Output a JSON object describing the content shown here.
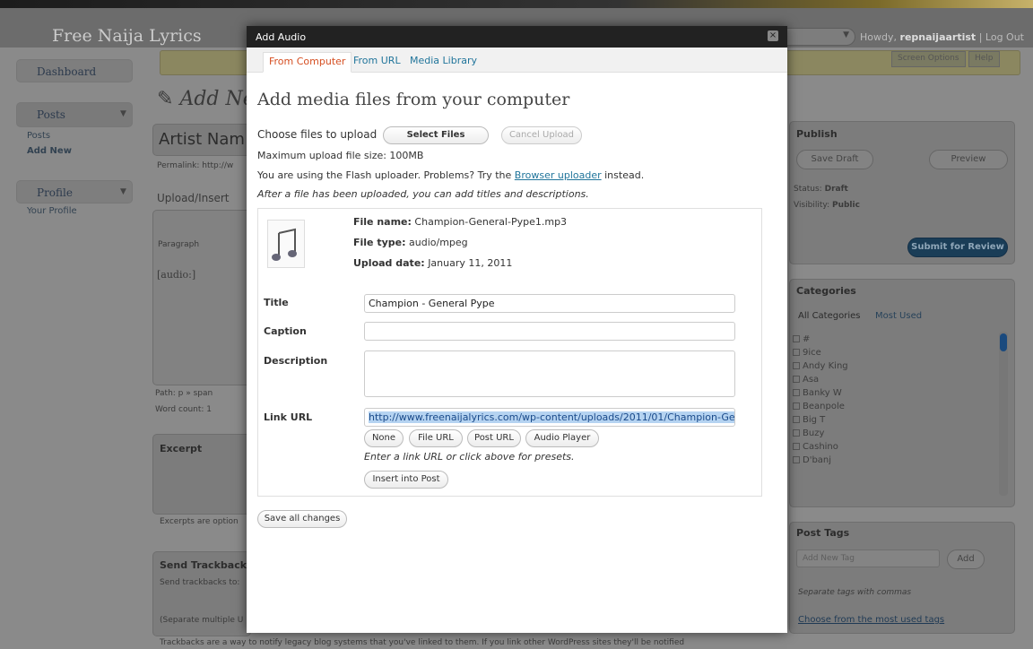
{
  "site": {
    "title": "Free Naija Lyrics",
    "howdy_prefix": "Howdy,",
    "user": "repnaijaartist",
    "separator": "|",
    "logout": "Log Out",
    "screen_options": "Screen Options",
    "help": "Help"
  },
  "sidebar": {
    "dashboard": "Dashboard",
    "posts": "Posts",
    "posts_sub": [
      "Posts",
      "Add New"
    ],
    "profile": "Profile",
    "profile_sub": [
      "Your Profile"
    ]
  },
  "editor": {
    "page_title": "Add Ne",
    "post_title": "Artist Nam",
    "permalink": "Permalink: http://w",
    "upload_insert": "Upload/Insert",
    "paragraph": "Paragraph",
    "content": "[audio:]",
    "path": "Path: p » span",
    "word_count": "Word count: 1",
    "excerpt_title": "Excerpt",
    "excerpt_note": "Excerpts are option",
    "trackbacks_title": "Send Trackbacks",
    "trackbacks_to": "Send trackbacks to:",
    "trackbacks_sep": "(Separate multiple U",
    "trackbacks_info": "Trackbacks are a way to notify legacy blog systems that you've linked to them. If you link other WordPress sites they'll be notified"
  },
  "publish": {
    "title": "Publish",
    "save_draft": "Save Draft",
    "preview": "Preview",
    "status_label": "Status:",
    "status": "Draft",
    "visibility_label": "Visibility:",
    "visibility": "Public",
    "submit": "Submit for Review"
  },
  "categories": {
    "title": "Categories",
    "tab_all": "All Categories",
    "tab_most": "Most Used",
    "items": [
      "#",
      "9ice",
      "Andy King",
      "Asa",
      "Banky W",
      "Beanpole",
      "Big T",
      "Buzy",
      "Cashino",
      "D'banj"
    ]
  },
  "tags": {
    "title": "Post Tags",
    "placeholder": "Add New Tag",
    "add": "Add",
    "hint": "Separate tags with commas",
    "choose": "Choose from the most used tags"
  },
  "modal": {
    "title": "Add Audio",
    "close": "×",
    "tabs": [
      "From Computer",
      "From URL",
      "Media Library"
    ],
    "heading": "Add media files from your computer",
    "choose_label": "Choose files to upload",
    "select_files": "Select Files",
    "cancel_upload": "Cancel Upload",
    "max_size": "Maximum upload file size: 100MB",
    "flash_pre": "You are using the Flash uploader. Problems? Try the",
    "flash_link": "Browser uploader",
    "flash_post": "instead.",
    "after_upload": "After a file has been uploaded, you can add titles and descriptions.",
    "file": {
      "name_label": "File name:",
      "name": "Champion-General-Pype1.mp3",
      "type_label": "File type:",
      "type": "audio/mpeg",
      "date_label": "Upload date:",
      "date": "January 11, 2011"
    },
    "fields": {
      "title_label": "Title",
      "title_value": "Champion - General Pype",
      "caption_label": "Caption",
      "caption_value": "",
      "description_label": "Description",
      "description_value": "",
      "link_label": "Link URL",
      "link_value": "http://www.freenaijalyrics.com/wp-content/uploads/2011/01/Champion-Ge"
    },
    "link_buttons": [
      "None",
      "File URL",
      "Post URL",
      "Audio Player"
    ],
    "link_hint": "Enter a link URL or click above for presets.",
    "insert": "Insert into Post",
    "save_all": "Save all changes"
  }
}
